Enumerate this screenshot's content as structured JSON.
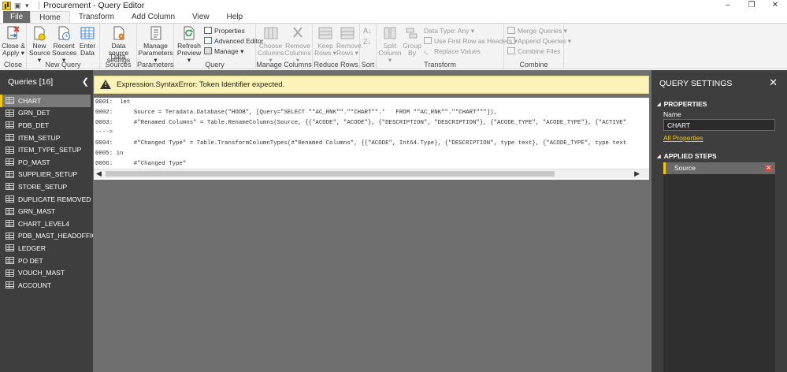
{
  "window": {
    "title": "Procurement - Query Editor",
    "controls": [
      "–",
      "❐",
      "✕"
    ]
  },
  "ribbon_tabs": [
    "File",
    "Home",
    "Transform",
    "Add Column",
    "View",
    "Help"
  ],
  "ribbon": {
    "close_group": {
      "label": "Close",
      "close_apply": "Close &",
      "close_apply2": "Apply ▾"
    },
    "new_query_group": {
      "label": "New Query",
      "new_source": "New",
      "new_source2": "Source ▾",
      "recent_sources": "Recent",
      "recent_sources2": "Sources ▾",
      "enter_data": "Enter",
      "enter_data2": "Data"
    },
    "data_sources_group": {
      "label": "Data Sources",
      "settings": "Data source",
      "settings2": "settings"
    },
    "parameters_group": {
      "label": "Parameters",
      "manage": "Manage",
      "manage2": "Parameters ▾"
    },
    "query_group": {
      "label": "Query",
      "refresh": "Refresh",
      "refresh2": "Preview ▾",
      "properties": "Properties",
      "advanced_editor": "Advanced Editor",
      "manage": "Manage ▾"
    },
    "manage_columns_group": {
      "label": "Manage Columns",
      "choose": "Choose",
      "choose2": "Columns ▾",
      "remove": "Remove",
      "remove2": "Columns ▾"
    },
    "reduce_rows_group": {
      "label": "Reduce Rows",
      "keep": "Keep",
      "keep2": "Rows ▾",
      "remove": "Remove",
      "remove2": "Rows ▾"
    },
    "sort_group": {
      "label": "Sort"
    },
    "transform_group": {
      "label": "Transform",
      "split": "Split",
      "split2": "Column ▾",
      "group": "Group",
      "group2": "By",
      "data_type": "Data Type: Any ▾",
      "first_row": "Use First Row as Headers ▾",
      "replace": "Replace Values"
    },
    "combine_group": {
      "label": "Combine",
      "merge": "Merge Queries ▾",
      "append": "Append Queries ▾",
      "combine_files": "Combine Files"
    }
  },
  "queries": {
    "header": "Queries [16]",
    "chevron": "❮",
    "items": [
      "CHART",
      "GRN_DET",
      "PDB_DET",
      "ITEM_SETUP",
      "ITEM_TYPE_SETUP",
      "PO_MAST",
      "SUPPLIER_SETUP",
      "STORE_SETUP",
      "DUPLICATE REMOVED",
      "GRN_MAST",
      "CHART_LEVEL4",
      "PDB_MAST_HEADOFFICE",
      "LEDGER",
      "PO DET",
      "VOUCH_MAST",
      "ACCOUNT"
    ],
    "selected": "CHART"
  },
  "error": {
    "icon": "!",
    "message": "Expression.SyntaxError: Token Identifier expected."
  },
  "code_lines": [
    "0001:  let",
    "0002:      Source = Teradata.Database(\"HODB\", [Query=\"SELECT \"\"AC_RNK\"\".\"\"CHART\"\".*   FROM \"\"AC_RNK\"\".\"\"CHART\"\"\"]),",
    "0003:      #\"Renamed Columns\" = Table.RenameColumns(Source, {{\"ACODE\", \"ACODE\"}, {\"DESCRIPTION\", \"DESCRIPTION\"}, {\"ACODE_TYPE\", \"ACODE_TYPE\"}, {\"ACTIVE\"",
    "---->",
    "0004:      #\"Changed Type\" = Table.TransformColumnTypes(#\"Renamed Columns\", {{\"ACODE\", Int64.Type}, {\"DESCRIPTION\", type text}, {\"ACODE_TYPE\", type text",
    "0005: in",
    "0006:      #\"Changed Type\""
  ],
  "settings": {
    "header": "QUERY SETTINGS",
    "close": "✕",
    "properties_title": "PROPERTIES",
    "name_label": "Name",
    "name_value": "CHART",
    "all_properties": "All Properties",
    "applied_steps_title": "APPLIED STEPS",
    "steps": [
      "Source"
    ],
    "step_delete": "✕"
  },
  "colors": {
    "accent": "#f2c811",
    "pane_bg": "#3e3e3e",
    "center_bg": "#6f6f6f",
    "error_bg": "#fbf3b7"
  }
}
